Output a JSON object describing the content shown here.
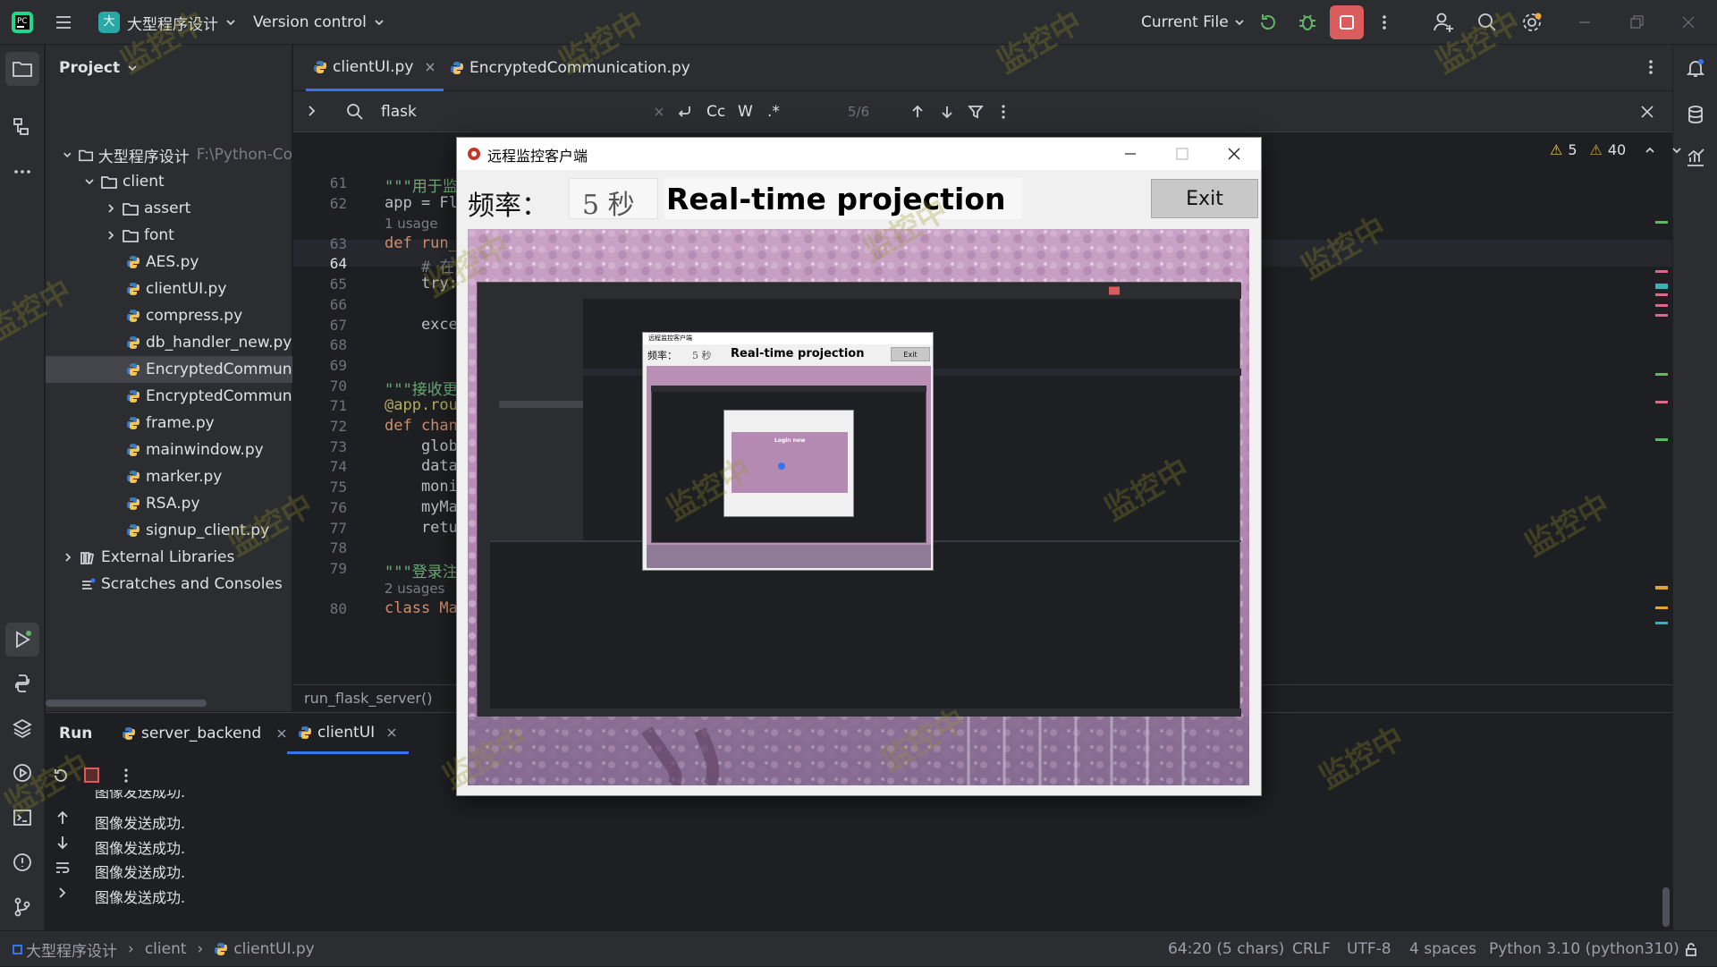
{
  "topbar": {
    "project_name": "大型程序设计",
    "project_badge": "大",
    "vcs": "Version control",
    "run_config": "Current File"
  },
  "project_panel": {
    "title": "Project",
    "root_name": "大型程序设计",
    "root_path": "F:\\Python-Co",
    "client": "client",
    "folders": [
      "assert",
      "font"
    ],
    "files": [
      "AES.py",
      "clientUI.py",
      "compress.py",
      "db_handler_new.py",
      "EncryptedCommunic",
      "EncryptedCommunic",
      "frame.py",
      "mainwindow.py",
      "marker.py",
      "RSA.py",
      "signup_client.py"
    ],
    "external": "External Libraries",
    "scratches": "Scratches and Consoles"
  },
  "editor": {
    "tabs": [
      "clientUI.py",
      "EncryptedCommunication.py"
    ],
    "search": {
      "query": "flask",
      "count": "5/6",
      "cc": "Cc",
      "w": "W",
      "regex": ".*"
    },
    "inspections": {
      "warnings": "5",
      "weak_warnings": "40"
    },
    "lines": [
      {
        "n": "61",
        "code": "\"\"\"用于监"
      },
      {
        "n": "62",
        "code": "app = Fl"
      },
      {
        "n": "",
        "hint": "1 usage"
      },
      {
        "n": "63",
        "code": "def run_"
      },
      {
        "n": "64",
        "code": "    # 在"
      },
      {
        "n": "65",
        "code": "    try:"
      },
      {
        "n": "66",
        "code": ""
      },
      {
        "n": "67",
        "code": "    exce"
      },
      {
        "n": "68",
        "code": ""
      },
      {
        "n": "69",
        "code": ""
      },
      {
        "n": "70",
        "code": "\"\"\"接收更"
      },
      {
        "n": "71",
        "code": "@app.rou"
      },
      {
        "n": "72",
        "code": "def chan"
      },
      {
        "n": "73",
        "code": "    glob"
      },
      {
        "n": "74",
        "code": "    data"
      },
      {
        "n": "75",
        "code": "    moni"
      },
      {
        "n": "76",
        "code": "    myMa"
      },
      {
        "n": "77",
        "code": "    retu"
      },
      {
        "n": "78",
        "code": ""
      },
      {
        "n": "79",
        "code": "\"\"\"登录注"
      },
      {
        "n": "",
        "hint": "2 usages"
      },
      {
        "n": "80",
        "code": "class Ma"
      }
    ],
    "breadcrumb": "run_flask_server()"
  },
  "run_panel": {
    "title": "Run",
    "tabs": [
      "server_backend",
      "clientUI"
    ],
    "log_partial": "图像发送成功.",
    "log_lines": [
      "图像发送成功.",
      "图像发送成功.",
      "图像发送成功.",
      "图像发送成功."
    ]
  },
  "statusbar": {
    "crumbs": [
      "大型程序设计",
      "client",
      "clientUI.py"
    ],
    "position": "64:20 (5 chars)",
    "line_sep": "CRLF",
    "encoding": "UTF-8",
    "indent": "4 spaces",
    "interpreter": "Python 3.10 (python310)"
  },
  "client_window": {
    "title": "远程监控客户端",
    "freq_label": "频率：",
    "freq_value": "5 秒",
    "heading": "Real-time projection",
    "exit": "Exit",
    "nested_title": "远程监控客户端",
    "nested_freq_label": "频率：",
    "nested_freq_value": "5 秒",
    "nested_heading": "Real-time projection",
    "nested_exit": "Exit",
    "nested_login": "Login now"
  },
  "watermark": "监控中",
  "colors": {
    "accent": "#3574f0",
    "python": "#f2c55c",
    "stop": "#db5c5c",
    "pink": "#c79bc4"
  }
}
